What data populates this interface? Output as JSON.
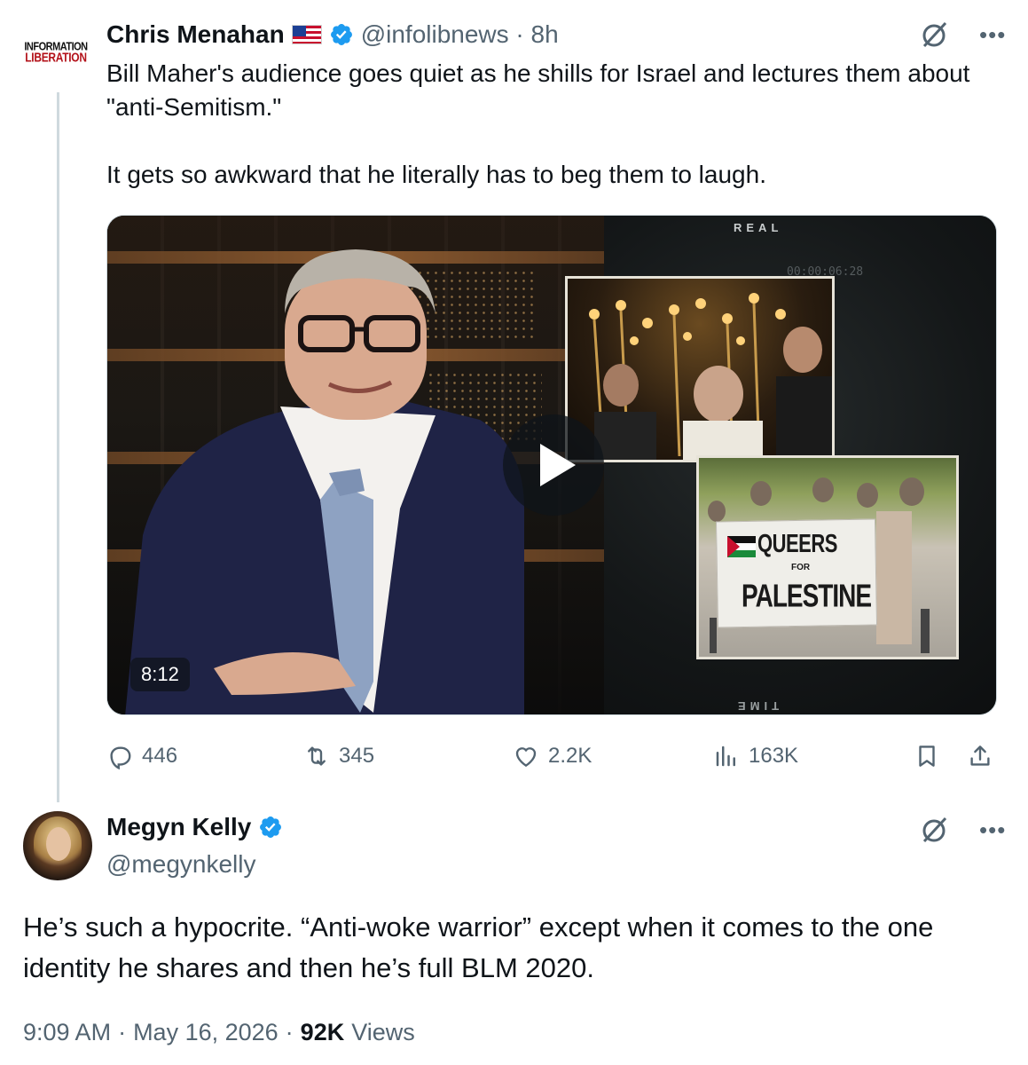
{
  "parent": {
    "avatar_logo_top": "INFORMATION",
    "avatar_logo_bottom": "LIBERATION",
    "name": "Chris Menahan",
    "flag": "us-flag-icon",
    "handle_time": "@infolibnews · 8h",
    "text": "Bill Maher's audience goes quiet as he shills for Israel and lectures them about \"anti-Semitism.\"\n\nIt gets so awkward that he literally has to beg them to laugh.",
    "video": {
      "duration": "8:12",
      "overlay_top": "REAL",
      "overlay_bottom": "TIME",
      "timecode": "00:00:06:28",
      "banner_line1": "QUEERS",
      "banner_line2": "FOR",
      "banner_line3": "PALESTINE"
    },
    "actions": {
      "replies": "446",
      "reposts": "345",
      "likes": "2.2K",
      "views": "163K"
    }
  },
  "main": {
    "name": "Megyn Kelly",
    "handle": "@megynkelly",
    "text": "He’s such a hypocrite. “Anti-woke warrior” except when it comes to the one identity he shares and then he’s full BLM 2020.",
    "time": "9:09 AM",
    "date": "May 16, 2026",
    "views_count": "92K",
    "views_label": "Views"
  },
  "colors": {
    "text_primary": "#0f1419",
    "text_secondary": "#536471",
    "verified": "#1d9bf0",
    "thread_line": "#cfd9de"
  }
}
